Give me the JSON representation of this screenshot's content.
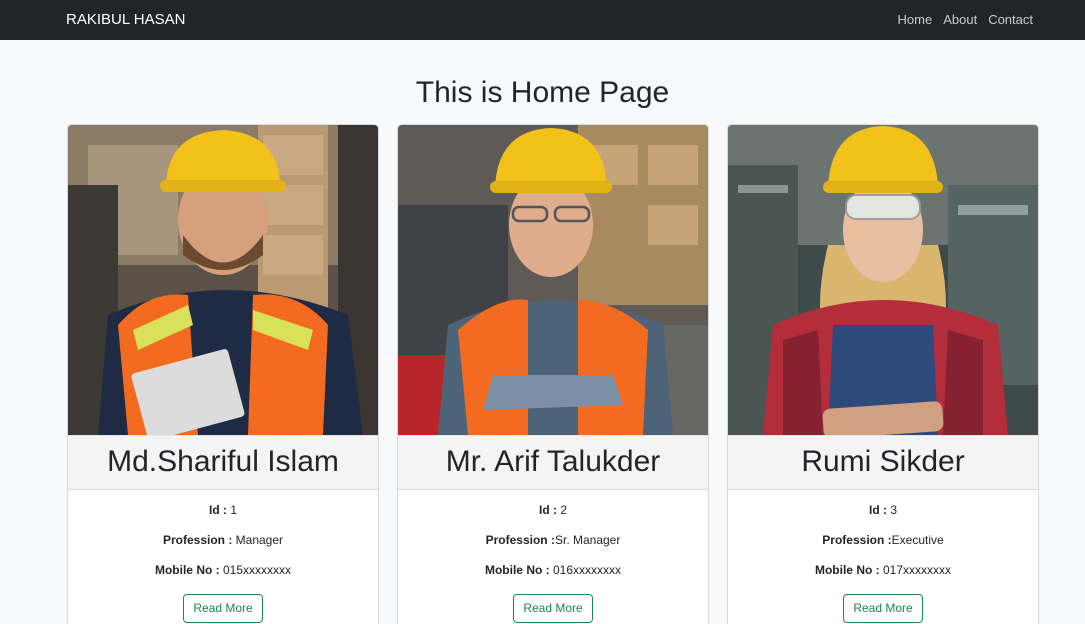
{
  "nav": {
    "brand": "RAKIBUL HASAN",
    "links": [
      "Home",
      "About",
      "Contact"
    ]
  },
  "page_title": "This is Home Page",
  "cards": [
    {
      "name": "Md.Shariful Islam",
      "id_label": "Id : ",
      "id": "1",
      "profession_label": "Profession : ",
      "profession": "Manager",
      "mobile_label": "Mobile No : ",
      "mobile": "015xxxxxxxx",
      "button": "Read More",
      "photo": "worker-photo"
    },
    {
      "name": "Mr. Arif Talukder",
      "id_label": "Id : ",
      "id": "2",
      "profession_label": "Profession :",
      "profession": "Sr. Manager",
      "mobile_label": "Mobile No : ",
      "mobile": "016xxxxxxxx",
      "button": "Read More",
      "photo": "worker-photo"
    },
    {
      "name": "Rumi Sikder",
      "id_label": "Id : ",
      "id": "3",
      "profession_label": "Profession :",
      "profession": "Executive",
      "mobile_label": "Mobile No : ",
      "mobile": "017xxxxxxxx",
      "button": "Read More",
      "photo": "worker-photo"
    }
  ],
  "colors": {
    "navbar": "#212529",
    "button": "#198754",
    "helmet": "#f2c21b",
    "vest": "#f26b21"
  }
}
